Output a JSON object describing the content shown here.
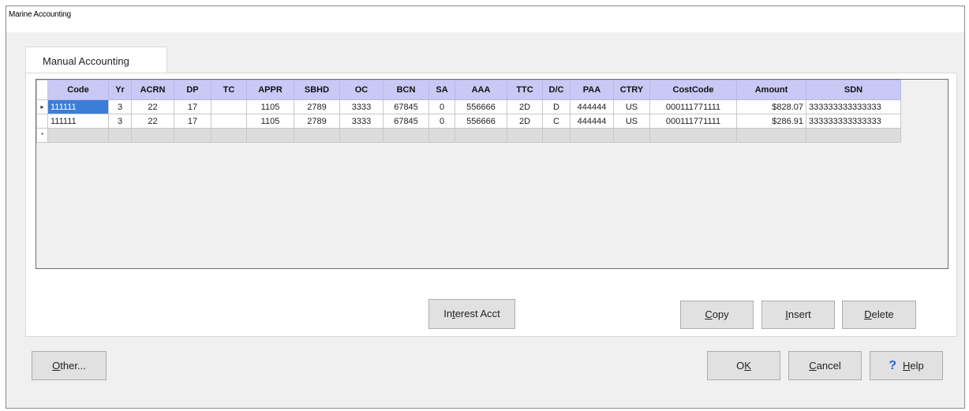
{
  "window": {
    "title": "Marine Accounting"
  },
  "tabs": [
    {
      "label": "Manual Accounting"
    }
  ],
  "grid": {
    "columns": [
      "Code",
      "Yr",
      "ACRN",
      "DP",
      "TC",
      "APPR",
      "SBHD",
      "OC",
      "BCN",
      "SA",
      "AAA",
      "TTC",
      "D/C",
      "PAA",
      "CTRY",
      "CostCode",
      "Amount",
      "SDN"
    ],
    "rows": [
      {
        "indicator": "▸",
        "cells": [
          "111111",
          "3",
          "22",
          "17",
          "",
          "1105",
          "2789",
          "3333",
          "67845",
          "0",
          "556666",
          "2D",
          "D",
          "444444",
          "US",
          "000111771111",
          "$828.07",
          "333333333333333"
        ]
      },
      {
        "indicator": "",
        "cells": [
          "111111",
          "3",
          "22",
          "17",
          "",
          "1105",
          "2789",
          "3333",
          "67845",
          "0",
          "556666",
          "2D",
          "C",
          "444444",
          "US",
          "000111771111",
          "$286.91",
          "333333333333333"
        ]
      }
    ],
    "new_row_indicator": "*"
  },
  "buttons": {
    "interest_acct": {
      "pre": "In",
      "u": "t",
      "post": "erest Acct"
    },
    "copy": {
      "pre": "",
      "u": "C",
      "post": "opy"
    },
    "insert": {
      "pre": "",
      "u": "I",
      "post": "nsert"
    },
    "delete": {
      "pre": "",
      "u": "D",
      "post": "elete"
    },
    "other": {
      "pre": "",
      "u": "O",
      "post": "ther..."
    },
    "ok": {
      "pre": "O",
      "u": "K",
      "post": ""
    },
    "cancel": {
      "pre": "",
      "u": "C",
      "post": "ancel"
    },
    "help": {
      "pre": "",
      "u": "H",
      "post": "elp",
      "icon": "?"
    }
  }
}
